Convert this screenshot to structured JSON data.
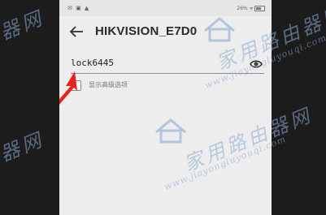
{
  "status_bar": {
    "left_icons": "✉ ▣ ▲",
    "right_text": "26% ᯤ"
  },
  "app_bar": {
    "back_icon": "arrow-left-icon",
    "title": "HIKVISION_E7D0"
  },
  "password_field": {
    "value": "lock6445",
    "toggle_icon": "eye-icon"
  },
  "advanced_options": {
    "label": "显示高级选项",
    "checked": false
  },
  "annotation": {
    "arrow_color": "#e8231f"
  },
  "watermark": {
    "text_cn": "家用路由器网",
    "text_en": "www.jiayongluyouqi.com"
  }
}
